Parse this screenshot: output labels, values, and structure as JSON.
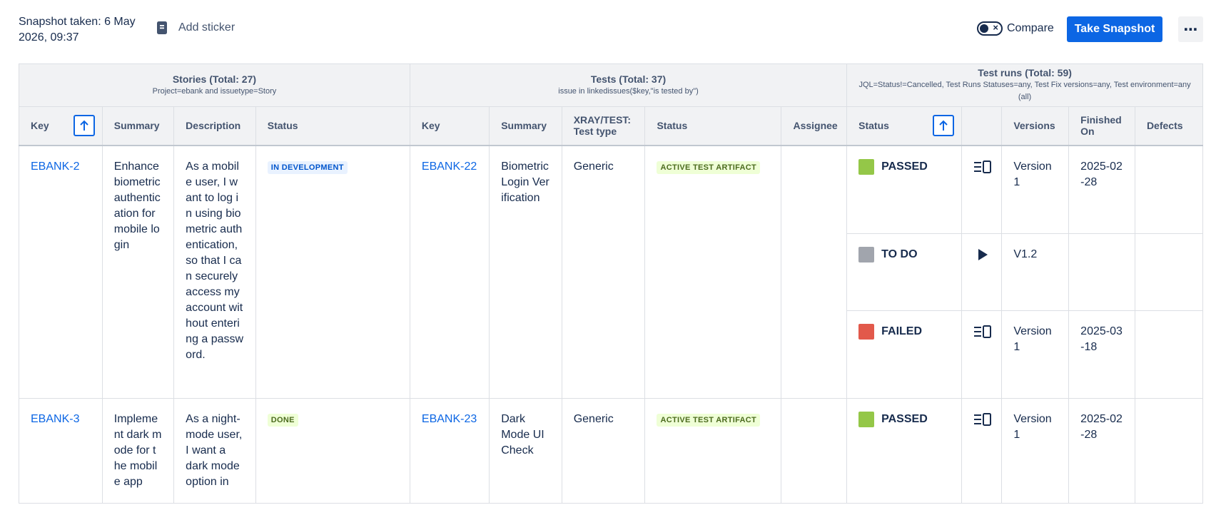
{
  "header": {
    "snapshot_text": "Snapshot taken: 6 May 2026, 09:37",
    "add_sticker_label": "Add sticker",
    "compare_label": "Compare",
    "take_snapshot_label": "Take Snapshot",
    "more_label": "⋯"
  },
  "groups": {
    "stories": {
      "title": "Stories (Total: 27)",
      "subtitle": "Project=ebank and issuetype=Story"
    },
    "tests": {
      "title": "Tests (Total: 37)",
      "subtitle": "issue in linkedissues($key,\"is tested by\")"
    },
    "runs": {
      "title": "Test runs (Total: 59)",
      "subtitle": "JQL=Status!=Cancelled, Test Runs Statuses=any, Test Fix versions=any, Test environment=any (all)"
    }
  },
  "columns": {
    "story_key": "Key",
    "story_summary": "Summary",
    "story_description": "Description",
    "story_status": "Status",
    "test_key": "Key",
    "test_summary": "Summary",
    "test_type": "XRAY/TEST: Test type",
    "test_status": "Status",
    "test_assignee": "Assignee",
    "run_status": "Status",
    "run_exec": "",
    "run_versions": "Versions",
    "run_finished": "Finished On",
    "run_defects": "Defects"
  },
  "stories": [
    {
      "key": "EBANK-2",
      "summary": "Enhance biometric authentication for mobile login",
      "description": "As a mobile user, I want to log in using biometric authentication, so that I can securely access my account without entering a password.",
      "status": "IN DEVELOPMENT",
      "test": {
        "key": "EBANK-22",
        "summary": "Biometric Login Verification",
        "type": "Generic",
        "status": "ACTIVE TEST ARTIFACT",
        "assignee": ""
      },
      "runs": [
        {
          "status": "PASSED",
          "color": "#94c748",
          "exec_icon": "execution-details-icon",
          "versions": "Version 1",
          "finished": "2025-02-28",
          "defects": ""
        },
        {
          "status": "TO DO",
          "color": "#a1a5ad",
          "exec_icon": "play-icon",
          "versions": "V1.2",
          "finished": "",
          "defects": ""
        },
        {
          "status": "FAILED",
          "color": "#e2594b",
          "exec_icon": "execution-details-icon",
          "versions": "Version 1",
          "finished": "2025-03-18",
          "defects": ""
        }
      ]
    },
    {
      "key": "EBANK-3",
      "summary": "Implement dark mode for the mobile app",
      "description": "As a night-mode user, I want a dark mode option in",
      "status": "DONE",
      "test": {
        "key": "EBANK-23",
        "summary": "Dark Mode UI Check",
        "type": "Generic",
        "status": "ACTIVE TEST ARTIFACT",
        "assignee": ""
      },
      "runs": [
        {
          "status": "PASSED",
          "color": "#94c748",
          "exec_icon": "execution-details-icon",
          "versions": "Version 1",
          "finished": "2025-02-28",
          "defects": ""
        }
      ]
    }
  ]
}
